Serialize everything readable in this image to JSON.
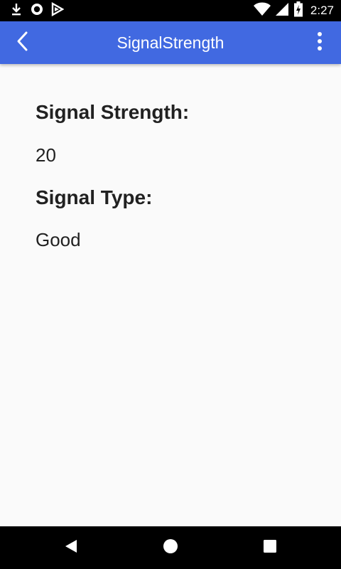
{
  "status_bar": {
    "time": "2:27",
    "left_icons": [
      "download-icon",
      "sync-icon",
      "play-store-icon"
    ],
    "right_icons": [
      "wifi-icon",
      "cell-signal-icon",
      "battery-charging-icon"
    ]
  },
  "app_bar": {
    "title": "SignalStrength",
    "color": "#4169e1",
    "back_icon": "chevron-left-icon",
    "menu_icon": "more-vert-icon"
  },
  "content": {
    "signal_strength_label": "Signal Strength:",
    "signal_strength_value": "20",
    "signal_type_label": "Signal Type:",
    "signal_type_value": "Good"
  },
  "nav_bar": {
    "icons": [
      "back-triangle-icon",
      "home-circle-icon",
      "recents-square-icon"
    ]
  }
}
